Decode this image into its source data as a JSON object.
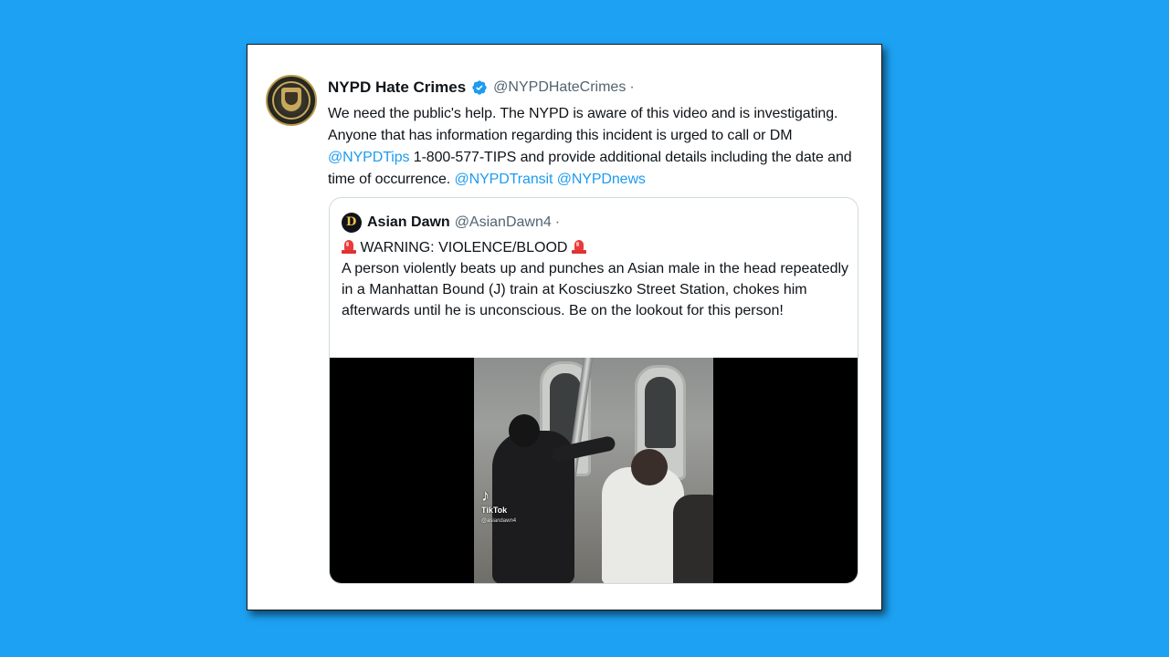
{
  "tweet": {
    "author_name": "NYPD Hate Crimes",
    "author_handle": "@NYPDHateCrimes",
    "separator": "·",
    "text_part1": "We need the public's help. The NYPD is aware of this video and is investigating. Anyone that has information regarding this incident is urged to call or DM ",
    "mention_tips": "@NYPDTips",
    "text_part2": " 1-800-577-TIPS and provide additional details including the date and time of occurrence.  ",
    "mention_transit": "@NYPDTransit",
    "mention_news": "@NYPDnews",
    "verified_icon": "verified-badge-icon",
    "avatar_icon": "nypd-seal-avatar"
  },
  "quoted_tweet": {
    "author_name": "Asian Dawn",
    "author_handle": "@AsianDawn4",
    "separator": "·",
    "warning_text": " WARNING: VIOLENCE/BLOOD ",
    "body": "A person violently beats up and punches an Asian male in the head repeatedly in a Manhattan Bound (J) train at Kosciuszko Street Station, chokes him afterwards until he is unconscious. Be on the lookout for this person!",
    "warning_icon": "police-siren-icon",
    "media": {
      "watermark": "TikTok",
      "watermark_user": "@asiandawn4"
    }
  },
  "colors": {
    "background": "#1da1f2",
    "link": "#1d9bf0",
    "verified": "#1d9bf0",
    "text": "#0f1419",
    "secondary_text": "#536471"
  }
}
